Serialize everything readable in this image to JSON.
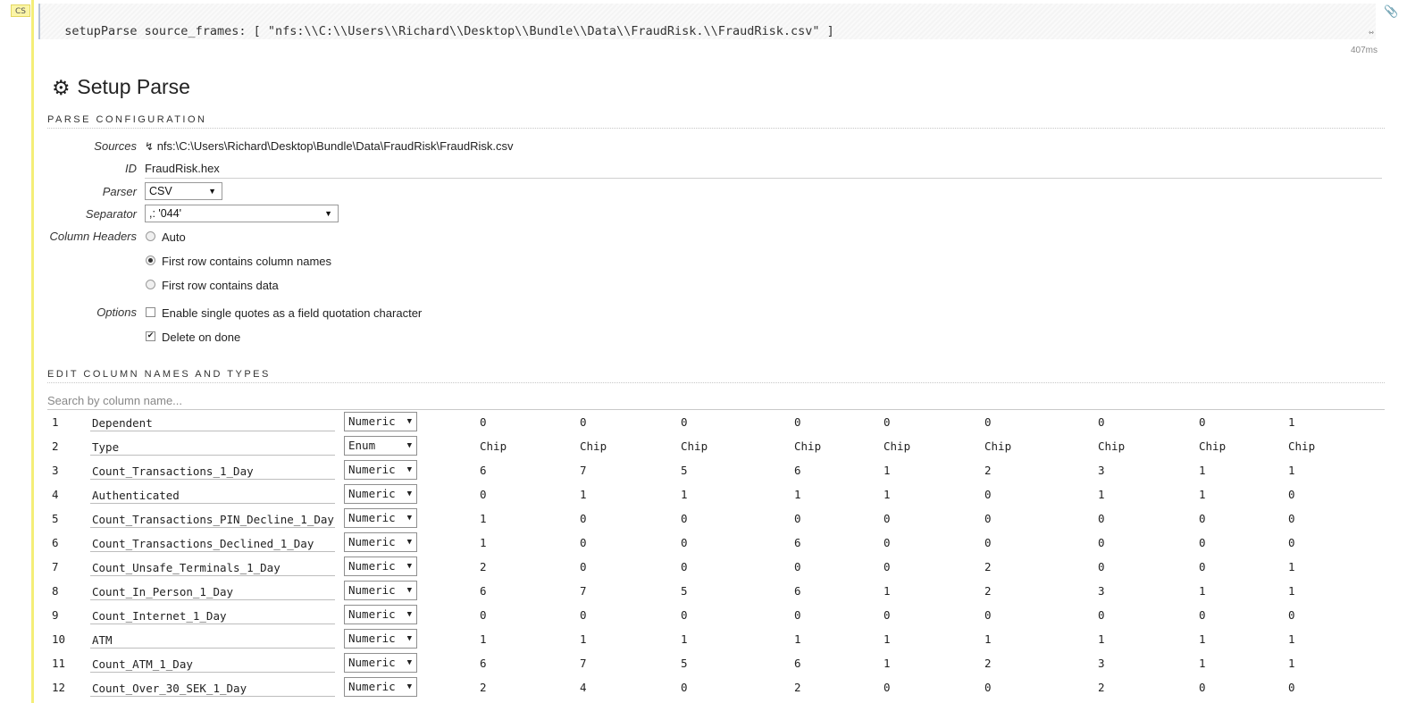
{
  "cell": {
    "badge": "CS",
    "code": "setupParse source_frames: [ \"nfs:\\\\C:\\\\Users\\\\Richard\\\\Desktop\\\\Bundle\\\\Data\\\\FraudRisk.\\\\FraudRisk.csv\" ]",
    "timing": "407ms",
    "clip_icon": "paperclip-icon"
  },
  "title": "Setup Parse",
  "title_icon": "gear-icon",
  "parse_config": {
    "heading": "PARSE CONFIGURATION",
    "sources_label": "Sources",
    "sources_value": "nfs:\\C:\\Users\\Richard\\Desktop\\Bundle\\Data\\FraudRisk\\FraudRisk.csv",
    "id_label": "ID",
    "id_value": "FraudRisk.hex",
    "parser_label": "Parser",
    "parser_value": "CSV",
    "separator_label": "Separator",
    "separator_value": ",: '044'",
    "column_headers_label": "Column Headers",
    "header_options": [
      "Auto",
      "First row contains column names",
      "First row contains data"
    ],
    "header_selected": 1,
    "options_label": "Options",
    "option_single_quotes": "Enable single quotes as a field quotation character",
    "option_single_quotes_checked": false,
    "option_delete_on_done": "Delete on done",
    "option_delete_on_done_checked": true
  },
  "columns_section": {
    "heading": "EDIT COLUMN NAMES AND TYPES",
    "search_placeholder": "Search by column name...",
    "rows": [
      {
        "num": "1",
        "name": "Dependent",
        "type": "Numeric",
        "values": [
          "0",
          "0",
          "0",
          "0",
          "0",
          "0",
          "0",
          "0",
          "1"
        ]
      },
      {
        "num": "2",
        "name": "Type",
        "type": "Enum",
        "values": [
          "Chip",
          "Chip",
          "Chip",
          "Chip",
          "Chip",
          "Chip",
          "Chip",
          "Chip",
          "Chip"
        ]
      },
      {
        "num": "3",
        "name": "Count_Transactions_1_Day",
        "type": "Numeric",
        "values": [
          "6",
          "7",
          "5",
          "6",
          "1",
          "2",
          "3",
          "1",
          "1"
        ]
      },
      {
        "num": "4",
        "name": "Authenticated",
        "type": "Numeric",
        "values": [
          "0",
          "1",
          "1",
          "1",
          "1",
          "0",
          "1",
          "1",
          "0"
        ]
      },
      {
        "num": "5",
        "name": "Count_Transactions_PIN_Decline_1_Day",
        "type": "Numeric",
        "values": [
          "1",
          "0",
          "0",
          "0",
          "0",
          "0",
          "0",
          "0",
          "0"
        ]
      },
      {
        "num": "6",
        "name": "Count_Transactions_Declined_1_Day",
        "type": "Numeric",
        "values": [
          "1",
          "0",
          "0",
          "6",
          "0",
          "0",
          "0",
          "0",
          "0"
        ]
      },
      {
        "num": "7",
        "name": "Count_Unsafe_Terminals_1_Day",
        "type": "Numeric",
        "values": [
          "2",
          "0",
          "0",
          "0",
          "0",
          "2",
          "0",
          "0",
          "1"
        ]
      },
      {
        "num": "8",
        "name": "Count_In_Person_1_Day",
        "type": "Numeric",
        "values": [
          "6",
          "7",
          "5",
          "6",
          "1",
          "2",
          "3",
          "1",
          "1"
        ]
      },
      {
        "num": "9",
        "name": "Count_Internet_1_Day",
        "type": "Numeric",
        "values": [
          "0",
          "0",
          "0",
          "0",
          "0",
          "0",
          "0",
          "0",
          "0"
        ]
      },
      {
        "num": "10",
        "name": "ATM",
        "type": "Numeric",
        "values": [
          "1",
          "1",
          "1",
          "1",
          "1",
          "1",
          "1",
          "1",
          "1"
        ]
      },
      {
        "num": "11",
        "name": "Count_ATM_1_Day",
        "type": "Numeric",
        "values": [
          "6",
          "7",
          "5",
          "6",
          "1",
          "2",
          "3",
          "1",
          "1"
        ]
      },
      {
        "num": "12",
        "name": "Count_Over_30_SEK_1_Day",
        "type": "Numeric",
        "values": [
          "2",
          "4",
          "0",
          "2",
          "0",
          "0",
          "2",
          "0",
          "0"
        ]
      }
    ]
  }
}
